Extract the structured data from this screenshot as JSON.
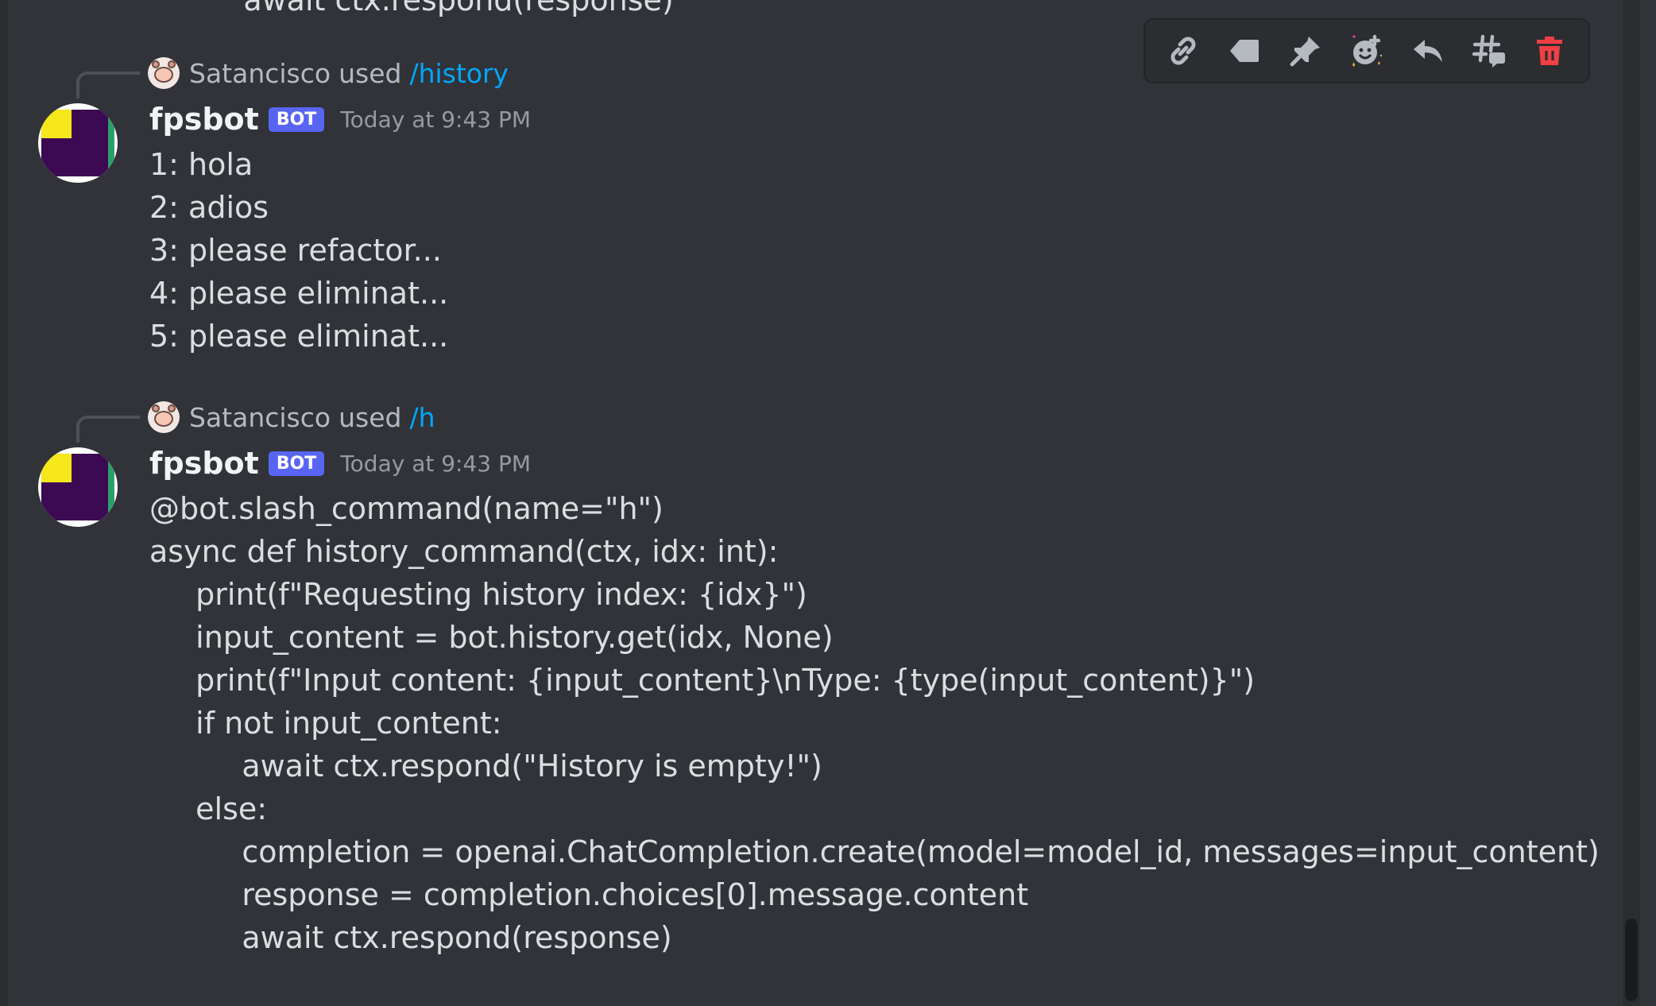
{
  "app": {
    "name": "Discord"
  },
  "overflow_line": "    await ctx.respond(response)",
  "toolbar": {
    "buttons": [
      {
        "name": "copy-link",
        "icon": "link-icon",
        "color": "#b5bac1"
      },
      {
        "name": "mark-unread",
        "icon": "tag-icon",
        "color": "#b5bac1"
      },
      {
        "name": "pin-message",
        "icon": "pin-icon",
        "color": "#b5bac1"
      },
      {
        "name": "add-super-reaction",
        "icon": "super-reaction-icon",
        "color": "#b5bac1"
      },
      {
        "name": "reply",
        "icon": "reply-icon",
        "color": "#b5bac1"
      },
      {
        "name": "create-thread",
        "icon": "thread-icon",
        "color": "#b5bac1"
      },
      {
        "name": "delete-message",
        "icon": "trash-icon",
        "color": "#f23f43"
      }
    ]
  },
  "messages": [
    {
      "reference": {
        "user": "Satancisco",
        "used": "used",
        "command": "/history"
      },
      "author": "fpsbot",
      "badge": "BOT",
      "timestamp": "Today at 9:43 PM",
      "lines": [
        "1: hola",
        "2: adios",
        "3: please refactor...",
        "4: please eliminat...",
        "5: please eliminat..."
      ]
    },
    {
      "reference": {
        "user": "Satancisco",
        "used": "used",
        "command": "/h"
      },
      "author": "fpsbot",
      "badge": "BOT",
      "timestamp": "Today at 9:43 PM",
      "lines": [
        "@bot.slash_command(name=\"h\")",
        "async def history_command(ctx, idx: int):",
        "  print(f\"Requesting history index: {idx}\")",
        "  input_content = bot.history.get(idx, None)",
        "  print(f\"Input content: {input_content}\\nType: {type(input_content)}\")",
        "  if not input_content:",
        "    await ctx.respond(\"History is empty!\")",
        "  else:",
        "    completion = openai.ChatCompletion.create(model=model_id, messages=input_content)",
        "    response = completion.choices[0].message.content",
        "    await ctx.respond(response)"
      ]
    }
  ],
  "colors": {
    "background": "#313338",
    "text": "#dbdee1",
    "muted": "#949ba4",
    "command_link": "#00a8fc",
    "bot_badge": "#5865f2",
    "danger": "#f23f43"
  }
}
